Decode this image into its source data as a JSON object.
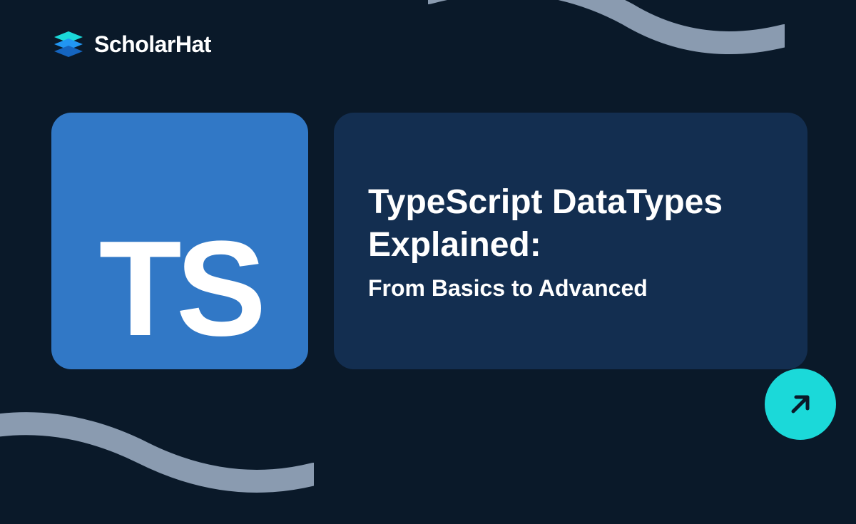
{
  "logo": {
    "brand_name": "ScholarHat"
  },
  "ts_badge": {
    "text": "TS"
  },
  "title": {
    "line1": "TypeScript DataTypes",
    "line2": "Explained:",
    "subtitle": "From Basics to Advanced"
  }
}
